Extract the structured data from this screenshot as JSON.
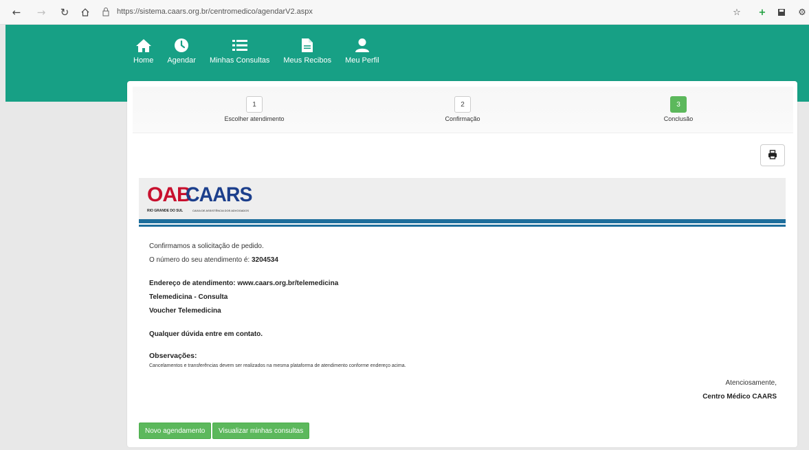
{
  "browser": {
    "url": "https://sistema.caars.org.br/centromedico/agendarV2.aspx",
    "back_icon": "arrow-left-icon",
    "forward_icon": "arrow-right-icon",
    "refresh_icon": "refresh-icon",
    "home_icon": "home-icon",
    "lock_icon": "lock-icon"
  },
  "menu": {
    "items": [
      {
        "label": "Home",
        "icon": "home-icon"
      },
      {
        "label": "Agendar",
        "icon": "clock-icon"
      },
      {
        "label": "Minhas Consultas",
        "icon": "list-icon"
      },
      {
        "label": "Meus Recibos",
        "icon": "document-icon"
      },
      {
        "label": "Meu Perfil",
        "icon": "user-icon"
      }
    ]
  },
  "steps": [
    {
      "number": "1",
      "label": "Escolher atendimento",
      "active": false
    },
    {
      "number": "2",
      "label": "Confirmação",
      "active": false
    },
    {
      "number": "3",
      "label": "Conclusão",
      "active": true
    }
  ],
  "logo": {
    "oab": "OAB",
    "caars": "CAARS",
    "sub1": "RIO GRANDE DO SUL",
    "sub2": "CAIXA DE ASSISTÊNCIA DOS ADVOGADOS"
  },
  "content": {
    "confirm": "Confirmamos a solicitação de pedido.",
    "number_label": "O número do seu atendimento é: ",
    "number_value": "3204534",
    "address": "Endereço de atendimento: www.caars.org.br/telemedicina",
    "service": "Telemedicina - Consulta",
    "voucher": "Voucher Telemedicina",
    "contact": "Qualquer dúvida entre em contato.",
    "obs_title": "Observações:",
    "obs_text": "Cancelamentos e transferências devem ser realizados na mesma plataforma de atendimento conforme endereço acima.",
    "regards": "Atenciosamente,",
    "signature": "Centro Médico CAARS"
  },
  "buttons": {
    "new": "Novo agendamento",
    "view": "Visualizar minhas consultas"
  },
  "colors": {
    "header": "#17a085",
    "button": "#5cb85c",
    "stripe": "#1e6e9c"
  }
}
